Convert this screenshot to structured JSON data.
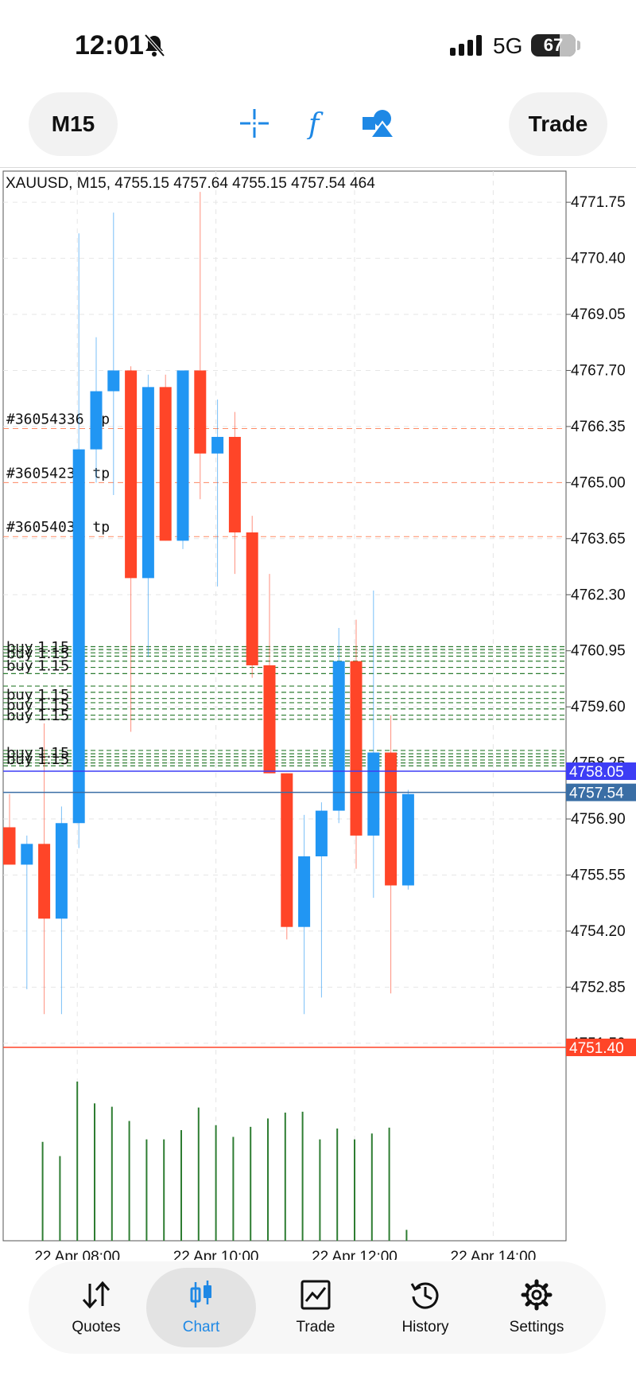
{
  "status_bar": {
    "time": "12:01",
    "network": "5G",
    "battery": "67",
    "icons": [
      "bell-slash-icon",
      "signal-bars-icon",
      "battery-icon"
    ]
  },
  "toolbar": {
    "timeframe_label": "M15",
    "trade_label": "Trade",
    "tools": [
      "crosshair-icon",
      "indicator-f-icon",
      "objects-icon"
    ],
    "accent_color": "#1e88e5"
  },
  "chart": {
    "header": "XAUUSD, M15, 4755.15 4757.64 4755.15 4757.54 464",
    "price_ticks": [
      "4771.75",
      "4770.40",
      "4769.05",
      "4767.70",
      "4766.35",
      "4765.00",
      "4763.65",
      "4762.30",
      "4760.95",
      "4759.60",
      "4758.25",
      "4756.90",
      "4755.55",
      "4754.20",
      "4752.85",
      "4751.50"
    ],
    "time_ticks": [
      "22 Apr 08:00",
      "22 Apr 10:00",
      "22 Apr 12:00",
      "22 Apr 14:00"
    ],
    "bid_price_badge": "4758.05",
    "last_price_badge": "4757.54",
    "stop_price_badge": "4751.40",
    "tp_labels": [
      "#36054336 tp",
      "#36054239 tp",
      "#36054031 tp"
    ],
    "buy_order_label": "buy 1.15",
    "colors": {
      "bull": "#2196f3",
      "bear": "#ff4528",
      "volume": "#2e7d32",
      "order_line": "#2e7d32",
      "tp_line": "#ff8a65",
      "bid_line": "#3d3df5",
      "last_line": "#3a6ea5"
    }
  },
  "chart_data": {
    "type": "candlestick",
    "symbol": "XAUUSD",
    "timeframe": "M15",
    "ylim": [
      4750.5,
      4772.5
    ],
    "candles": [
      {
        "o": 4756.7,
        "h": 4757.5,
        "l": 4756.1,
        "c": 4755.8
      },
      {
        "o": 4755.8,
        "h": 4756.5,
        "l": 4752.8,
        "c": 4756.3
      },
      {
        "o": 4756.3,
        "h": 4759.2,
        "l": 4752.2,
        "c": 4754.5
      },
      {
        "o": 4754.5,
        "h": 4757.2,
        "l": 4752.2,
        "c": 4756.8
      },
      {
        "o": 4756.8,
        "h": 4771.0,
        "l": 4756.2,
        "c": 4765.8
      },
      {
        "o": 4765.8,
        "h": 4768.5,
        "l": 4765.0,
        "c": 4767.2
      },
      {
        "o": 4767.2,
        "h": 4771.5,
        "l": 4764.7,
        "c": 4767.7
      },
      {
        "o": 4767.7,
        "h": 4767.8,
        "l": 4759.0,
        "c": 4762.7
      },
      {
        "o": 4762.7,
        "h": 4767.6,
        "l": 4760.8,
        "c": 4767.3
      },
      {
        "o": 4767.3,
        "h": 4767.6,
        "l": 4763.6,
        "c": 4763.6
      },
      {
        "o": 4763.6,
        "h": 4767.7,
        "l": 4763.4,
        "c": 4767.7
      },
      {
        "o": 4767.7,
        "h": 4772.0,
        "l": 4764.6,
        "c": 4765.7
      },
      {
        "o": 4765.7,
        "h": 4767.0,
        "l": 4762.5,
        "c": 4766.1
      },
      {
        "o": 4766.1,
        "h": 4766.7,
        "l": 4762.8,
        "c": 4763.8
      },
      {
        "o": 4763.8,
        "h": 4764.2,
        "l": 4760.3,
        "c": 4760.6
      },
      {
        "o": 4760.6,
        "h": 4762.8,
        "l": 4758.0,
        "c": 4758.0
      },
      {
        "o": 4758.0,
        "h": 4758.0,
        "l": 4754.0,
        "c": 4754.3
      },
      {
        "o": 4754.3,
        "h": 4757.0,
        "l": 4752.2,
        "c": 4756.0
      },
      {
        "o": 4756.0,
        "h": 4757.3,
        "l": 4752.6,
        "c": 4757.1
      },
      {
        "o": 4757.1,
        "h": 4761.5,
        "l": 4756.8,
        "c": 4760.7
      },
      {
        "o": 4760.7,
        "h": 4761.7,
        "l": 4755.7,
        "c": 4756.5
      },
      {
        "o": 4756.5,
        "h": 4762.4,
        "l": 4755.0,
        "c": 4758.5
      },
      {
        "o": 4758.5,
        "h": 4759.4,
        "l": 4752.7,
        "c": 4755.3
      },
      {
        "o": 4755.3,
        "h": 4757.6,
        "l": 4755.2,
        "c": 4757.5
      }
    ],
    "volumes": [
      0,
      0,
      1180,
      1010,
      1900,
      1640,
      1600,
      1430,
      1210,
      1210,
      1320,
      1590,
      1380,
      1240,
      1360,
      1460,
      1530,
      1540,
      1210,
      1340,
      1210,
      1280,
      1350,
      130
    ],
    "first_candle_partial": true,
    "tp_levels": [
      4766.3,
      4765.0,
      4763.7
    ],
    "buy_levels": [
      4761.05,
      4760.98,
      4760.9,
      4760.82,
      4760.7,
      4760.55,
      4760.4,
      4760.1,
      4759.95,
      4759.8,
      4759.7,
      4759.55,
      4759.4,
      4759.3,
      4758.55,
      4758.47,
      4758.4,
      4758.32,
      4758.25,
      4758.18
    ],
    "bid": 4758.05,
    "last": 4757.54,
    "stop": 4751.4,
    "x_labels": [
      "22 Apr 08:00",
      "22 Apr 10:00",
      "22 Apr 12:00",
      "22 Apr 14:00"
    ]
  },
  "bottom_nav": {
    "items": [
      {
        "label": "Quotes",
        "icon": "quotes-arrows-icon",
        "active": false
      },
      {
        "label": "Chart",
        "icon": "candles-icon",
        "active": true
      },
      {
        "label": "Trade",
        "icon": "trade-chart-icon",
        "active": false
      },
      {
        "label": "History",
        "icon": "history-clock-icon",
        "active": false
      },
      {
        "label": "Settings",
        "icon": "gear-icon",
        "active": false
      }
    ]
  }
}
